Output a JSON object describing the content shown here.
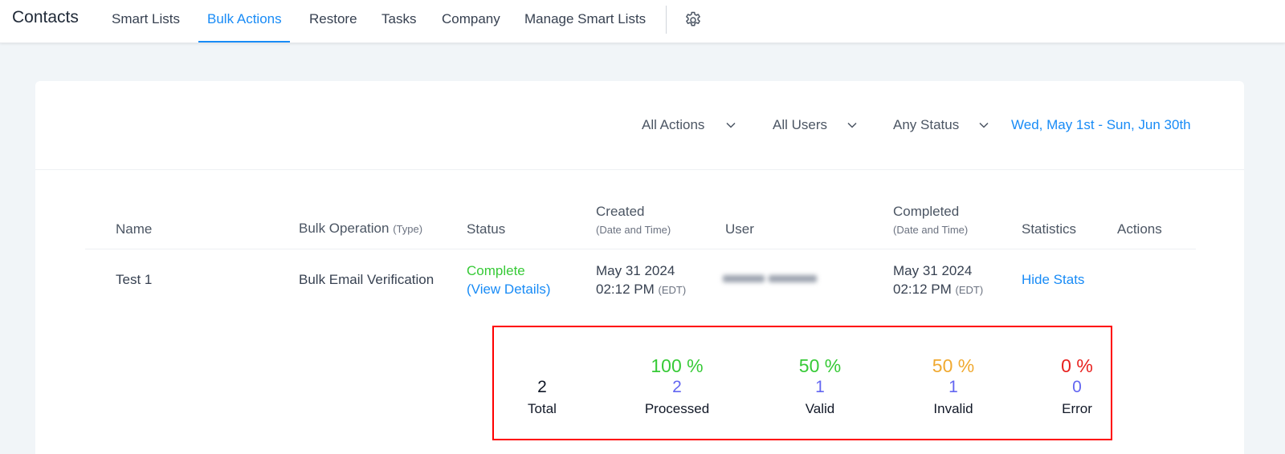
{
  "header": {
    "title": "Contacts",
    "tabs": [
      {
        "label": "Smart Lists"
      },
      {
        "label": "Bulk Actions"
      },
      {
        "label": "Restore"
      },
      {
        "label": "Tasks"
      },
      {
        "label": "Company"
      },
      {
        "label": "Manage Smart Lists"
      }
    ],
    "active_tab": "Bulk Actions",
    "settings_icon": "gear-icon"
  },
  "filters": {
    "actions": "All Actions",
    "users": "All Users",
    "status": "Any Status",
    "date_range": "Wed, May 1st - Sun, Jun 30th"
  },
  "table": {
    "columns": {
      "name": "Name",
      "operation": "Bulk Operation",
      "operation_sub": "(Type)",
      "status": "Status",
      "created": "Created",
      "created_sub": "(Date and Time)",
      "user": "User",
      "completed": "Completed",
      "completed_sub": "(Date and Time)",
      "statistics": "Statistics",
      "actions": "Actions"
    },
    "rows": [
      {
        "name": "Test 1",
        "operation": "Bulk Email Verification",
        "status": "Complete",
        "status_link": "(View Details)",
        "created_date": "May 31 2024",
        "created_time": "02:12 PM",
        "created_tz": "(EDT)",
        "completed_date": "May 31 2024",
        "completed_time": "02:12 PM",
        "completed_tz": "(EDT)",
        "statistics_link": "Hide Stats"
      }
    ]
  },
  "stats": {
    "total": {
      "value": "2",
      "label": "Total"
    },
    "processed": {
      "pct": "100 %",
      "value": "2",
      "label": "Processed",
      "color": "#37ca37"
    },
    "valid": {
      "pct": "50 %",
      "value": "1",
      "label": "Valid",
      "color": "#37ca37"
    },
    "invalid": {
      "pct": "50 %",
      "value": "1",
      "label": "Invalid",
      "color": "#f0a930"
    },
    "error": {
      "pct": "0 %",
      "value": "0",
      "label": "Error",
      "color": "#e8201e"
    },
    "count_color": "#6366f1",
    "highlight_color": "#ff0000"
  },
  "colors": {
    "accent": "#188bf6",
    "complete": "#37ca37"
  }
}
